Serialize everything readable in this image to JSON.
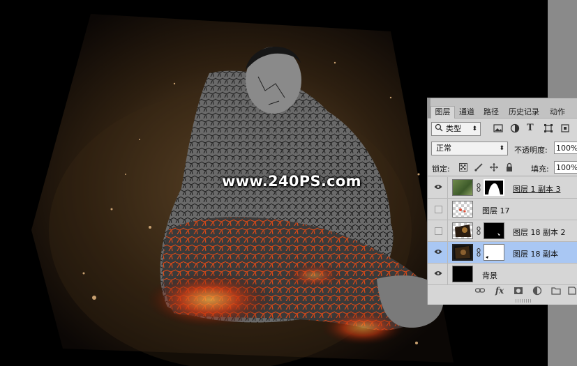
{
  "watermark": "www.240PS.com",
  "panel": {
    "tabs": [
      {
        "label": "图层",
        "active": true
      },
      {
        "label": "通道",
        "active": false
      },
      {
        "label": "路径",
        "active": false
      },
      {
        "label": "历史记录",
        "active": false
      },
      {
        "label": "动作",
        "active": false
      }
    ],
    "filter": {
      "value": "类型",
      "icons": [
        "image-filter-icon",
        "adjustment-filter-icon",
        "type-filter-icon",
        "shape-filter-icon",
        "smart-object-filter-icon"
      ]
    },
    "blend_mode": "正常",
    "opacity_label": "不透明度:",
    "opacity_value": "100%",
    "lock_label": "锁定:",
    "fill_label": "填充:",
    "fill_value": "100%",
    "layers": [
      {
        "name": "图层 1 副本 3",
        "visible": true,
        "has_mask": true,
        "selected": false,
        "underline": true
      },
      {
        "name": "图层 17",
        "visible": false,
        "has_mask": false,
        "selected": false,
        "underline": false
      },
      {
        "name": "图层 18 副本 2",
        "visible": false,
        "has_mask": true,
        "selected": false,
        "underline": false
      },
      {
        "name": "图层 18 副本",
        "visible": true,
        "has_mask": true,
        "selected": true,
        "underline": false
      },
      {
        "name": "背景",
        "visible": true,
        "has_mask": false,
        "selected": false,
        "underline": false
      }
    ],
    "bottom_icons": [
      "link-layers-icon",
      "fx-icon",
      "add-mask-icon",
      "adjustment-layer-icon",
      "new-group-icon",
      "new-layer-icon"
    ],
    "fx_label": "fx",
    "colors": {
      "panel_bg": "#d6d6d6",
      "selected_row": "#a9c7f3",
      "tab_bar": "#c2c2c2"
    }
  }
}
